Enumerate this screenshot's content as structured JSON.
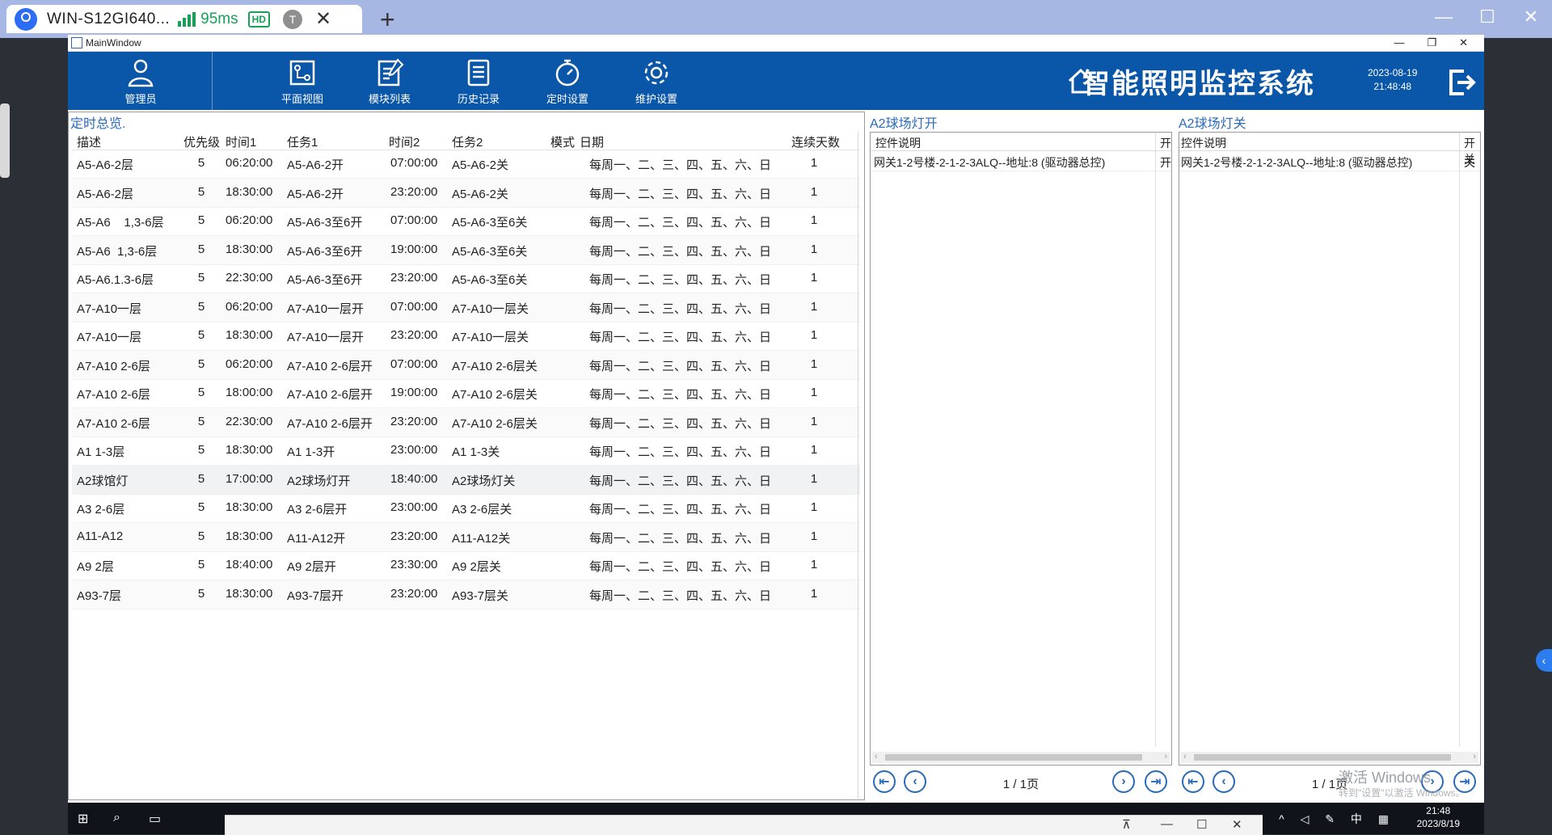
{
  "remote_tab": {
    "title": "WIN-S12GI640...",
    "ping": "95ms",
    "hd": "HD",
    "avatar_letter": "T"
  },
  "window": {
    "title": "MainWindow"
  },
  "toolbar": {
    "buttons": [
      "管理员",
      "平面视图",
      "模块列表",
      "历史记录",
      "定时设置",
      "维护设置"
    ],
    "system_title": "智能照明监控系统",
    "date": "2023-08-19",
    "time": "21:48:48"
  },
  "left_panel": {
    "caption": "定时总览.",
    "headers": {
      "desc": "描述",
      "priority": "优先级",
      "time1": "时间1",
      "task1": "任务1",
      "time2": "时间2",
      "task2": "任务2",
      "mode": "模式",
      "date": "日期",
      "days": "连续天数"
    },
    "rows": [
      {
        "desc": "A5-A6-2层",
        "priority": "5",
        "time1": "06:20:00",
        "task1": "A5-A6-2开",
        "time2": "07:00:00",
        "task2": "A5-A6-2关",
        "date": "每周一、二、三、四、五、六、日",
        "days": "1"
      },
      {
        "desc": "A5-A6-2层",
        "priority": "5",
        "time1": "18:30:00",
        "task1": "A5-A6-2开",
        "time2": "23:20:00",
        "task2": "A5-A6-2关",
        "date": "每周一、二、三、四、五、六、日",
        "days": "1"
      },
      {
        "desc": "A5-A6    1,3-6层",
        "priority": "5",
        "time1": "06:20:00",
        "task1": "A5-A6-3至6开",
        "time2": "07:00:00",
        "task2": "A5-A6-3至6关",
        "date": "每周一、二、三、四、五、六、日",
        "days": "1"
      },
      {
        "desc": "A5-A6  1,3-6层",
        "priority": "5",
        "time1": "18:30:00",
        "task1": "A5-A6-3至6开",
        "time2": "19:00:00",
        "task2": "A5-A6-3至6关",
        "date": "每周一、二、三、四、五、六、日",
        "days": "1"
      },
      {
        "desc": "A5-A6.1.3-6层",
        "priority": "5",
        "time1": "22:30:00",
        "task1": "A5-A6-3至6开",
        "time2": "23:20:00",
        "task2": "A5-A6-3至6关",
        "date": "每周一、二、三、四、五、六、日",
        "days": "1"
      },
      {
        "desc": "A7-A10一层",
        "priority": "5",
        "time1": "06:20:00",
        "task1": "A7-A10一层开",
        "time2": "07:00:00",
        "task2": "A7-A10一层关",
        "date": "每周一、二、三、四、五、六、日",
        "days": "1"
      },
      {
        "desc": "A7-A10一层",
        "priority": "5",
        "time1": "18:30:00",
        "task1": "A7-A10一层开",
        "time2": "23:20:00",
        "task2": "A7-A10一层关",
        "date": "每周一、二、三、四、五、六、日",
        "days": "1"
      },
      {
        "desc": "A7-A10 2-6层",
        "priority": "5",
        "time1": "06:20:00",
        "task1": "A7-A10 2-6层开",
        "time2": "07:00:00",
        "task2": "A7-A10 2-6层关",
        "date": "每周一、二、三、四、五、六、日",
        "days": "1"
      },
      {
        "desc": "A7-A10 2-6层",
        "priority": "5",
        "time1": "18:00:00",
        "task1": "A7-A10 2-6层开",
        "time2": "19:00:00",
        "task2": "A7-A10 2-6层关",
        "date": "每周一、二、三、四、五、六、日",
        "days": "1"
      },
      {
        "desc": "A7-A10 2-6层",
        "priority": "5",
        "time1": "22:30:00",
        "task1": "A7-A10 2-6层开",
        "time2": "23:20:00",
        "task2": "A7-A10 2-6层关",
        "date": "每周一、二、三、四、五、六、日",
        "days": "1"
      },
      {
        "desc": "A1 1-3层",
        "priority": "5",
        "time1": "18:30:00",
        "task1": "A1 1-3开",
        "time2": "23:00:00",
        "task2": "A1 1-3关",
        "date": "每周一、二、三、四、五、六、日",
        "days": "1"
      },
      {
        "desc": "A2球馆灯",
        "priority": "5",
        "time1": "17:00:00",
        "task1": "A2球场灯开",
        "time2": "18:40:00",
        "task2": "A2球场灯关",
        "date": "每周一、二、三、四、五、六、日",
        "days": "1"
      },
      {
        "desc": "A3 2-6层",
        "priority": "5",
        "time1": "18:30:00",
        "task1": "A3 2-6层开",
        "time2": "23:00:00",
        "task2": "A3 2-6层关",
        "date": "每周一、二、三、四、五、六、日",
        "days": "1"
      },
      {
        "desc": "A11-A12",
        "priority": "5",
        "time1": "18:30:00",
        "task1": "A11-A12开",
        "time2": "23:20:00",
        "task2": "A11-A12关",
        "date": "每周一、二、三、四、五、六、日",
        "days": "1"
      },
      {
        "desc": "A9 2层",
        "priority": "5",
        "time1": "18:40:00",
        "task1": "A9 2层开",
        "time2": "23:30:00",
        "task2": "A9 2层关",
        "date": "每周一、二、三、四、五、六、日",
        "days": "1"
      },
      {
        "desc": "A93-7层",
        "priority": "5",
        "time1": "18:30:00",
        "task1": "A93-7层开",
        "time2": "23:20:00",
        "task2": "A93-7层关",
        "date": "每周一、二、三、四、五、六、日",
        "days": "1"
      }
    ]
  },
  "panel_on": {
    "caption": "A2球场灯开",
    "headers": {
      "desc": "控件说明",
      "switch": "开"
    },
    "row": {
      "desc": "网关1-2号楼-2-1-2-3ALQ--地址:8 (驱动器总控)",
      "switch": "开"
    },
    "page": "1 / 1页"
  },
  "panel_off": {
    "caption": "A2球场灯关",
    "headers": {
      "desc": "控件说明",
      "switch": "开关"
    },
    "row": {
      "desc": "网关1-2号楼-2-1-2-3ALQ--地址:8 (驱动器总控)",
      "switch": "关"
    },
    "page": "1 / 1页"
  },
  "watermark": {
    "line1": "激活 Windows",
    "line2": "转到\"设置\"以激活 Windows。"
  },
  "taskbar": {
    "time": "21:48",
    "date": "2023/8/19",
    "ime": "中"
  }
}
